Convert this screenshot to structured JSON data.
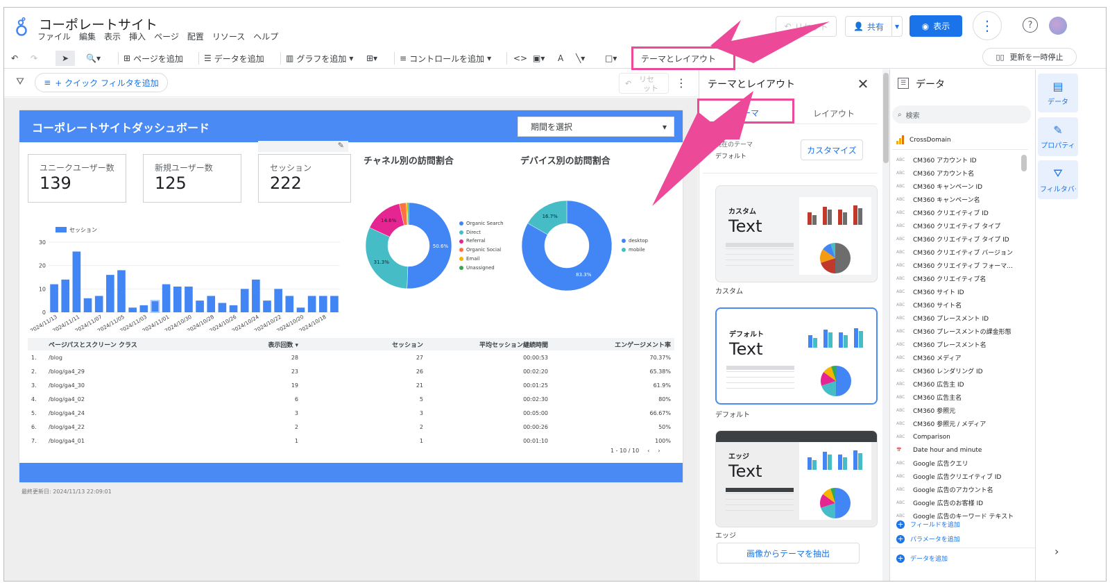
{
  "app": {
    "title": "コーポレートサイト",
    "menu": [
      "ファイル",
      "編集",
      "表示",
      "挿入",
      "ページ",
      "配置",
      "リソース",
      "ヘルプ"
    ],
    "reset_label": "リセット",
    "share_label": "共有",
    "view_label": "表示"
  },
  "toolbar": {
    "add_page": "ページを追加",
    "add_data": "データを追加",
    "add_chart": "グラフを追加",
    "add_control": "コントロールを追加",
    "theme_layout": "テーマとレイアウト",
    "pause_update": "更新を一時停止"
  },
  "filter_bar": {
    "quick_filter": "+ クイック フィルタを追加",
    "reset_top": "リセ",
    "reset_bottom": "ット"
  },
  "report": {
    "title": "コーポレートサイトダッシュボード",
    "date_selector": "期間を選択",
    "scorecards": [
      {
        "label": "ユニークユーザー数",
        "value": "139"
      },
      {
        "label": "新規ユーザー数",
        "value": "125"
      },
      {
        "label": "セッション",
        "value": "222"
      }
    ],
    "channel_title": "チャネル別の訪問割合",
    "device_title": "デバイス別の訪問割合",
    "last_updated": "最終更新日: 2024/11/13 22:09:01",
    "table": {
      "headers": [
        "ページパスとスクリーン クラス",
        "表示回数 ▾",
        "セッション",
        "平均セッション継続時間",
        "エンゲージメント率"
      ],
      "rows": [
        {
          "n": "1.",
          "path": "/blog",
          "views": "28",
          "sessions": "27",
          "dur": "00:00:53",
          "eng": "70.37%"
        },
        {
          "n": "2.",
          "path": "/blog/ga4_29",
          "views": "23",
          "sessions": "26",
          "dur": "00:02:20",
          "eng": "65.38%"
        },
        {
          "n": "3.",
          "path": "/blog/ga4_30",
          "views": "19",
          "sessions": "21",
          "dur": "00:01:25",
          "eng": "61.9%"
        },
        {
          "n": "4.",
          "path": "/blog/ga4_02",
          "views": "6",
          "sessions": "5",
          "dur": "00:02:30",
          "eng": "80%"
        },
        {
          "n": "5.",
          "path": "/blog/ga4_24",
          "views": "3",
          "sessions": "3",
          "dur": "00:05:00",
          "eng": "66.67%"
        },
        {
          "n": "6.",
          "path": "/blog/ga4_22",
          "views": "2",
          "sessions": "2",
          "dur": "00:00:26",
          "eng": "50%"
        },
        {
          "n": "7.",
          "path": "/blog/ga4_01",
          "views": "1",
          "sessions": "1",
          "dur": "00:01:10",
          "eng": "100%"
        }
      ],
      "pager": "1 - 10 / 10"
    }
  },
  "chart_data": [
    {
      "type": "bar",
      "series": [
        {
          "name": "セッション",
          "values": [
            12,
            14,
            26,
            6,
            7,
            16,
            18,
            2,
            3,
            5,
            12,
            11,
            11,
            5,
            7,
            4,
            3,
            10,
            14,
            5,
            10,
            7,
            2,
            7,
            7,
            7
          ]
        }
      ],
      "x_labels": [
        "2024/11/13",
        "2024/11/11",
        "2024/11/07",
        "2024/11/05",
        "2024/11/03",
        "2024/11/01",
        "2024/10/30",
        "2024/10/28",
        "2024/10/26",
        "2024/10/24",
        "2024/10/22",
        "2024/10/20",
        "2024/10/18"
      ],
      "yticks": [
        0,
        10,
        20,
        30
      ],
      "ylim": [
        0,
        30
      ]
    },
    {
      "type": "pie",
      "labels": [
        "Organic Search",
        "Direct",
        "Referral",
        "Organic Social",
        "Email",
        "Unassigned"
      ],
      "values": [
        50.6,
        31.3,
        14.6,
        2.5,
        0.5,
        0.5
      ],
      "colors": [
        "#4285f4",
        "#46bdc6",
        "#e52592",
        "#ff7043",
        "#f5b400",
        "#34a853"
      ],
      "data_labels": [
        "50.6%",
        "31.3%",
        "14.6%"
      ]
    },
    {
      "type": "pie",
      "labels": [
        "desktop",
        "mobile"
      ],
      "values": [
        83.3,
        16.7
      ],
      "colors": [
        "#4285f4",
        "#46bdc6"
      ],
      "data_labels": [
        "83.3%",
        "16.7%"
      ]
    }
  ],
  "theme_panel": {
    "title": "テーマとレイアウト",
    "tab_theme": "テーマ",
    "tab_layout": "レイアウト",
    "current_label": "現在のテーマ",
    "current_value": "デフォルト",
    "customize": "カスタマイズ",
    "cards": [
      {
        "tag": "カスタム",
        "text": "Text",
        "caption": "カスタム"
      },
      {
        "tag": "デフォルト",
        "text": "Text",
        "caption": "デフォルト"
      },
      {
        "tag": "エッジ",
        "text": "Text",
        "caption": "エッジ"
      }
    ],
    "extract": "画像からテーマを抽出"
  },
  "data_panel": {
    "title": "データ",
    "search_placeholder": "検索",
    "source": "CrossDomain",
    "fields": [
      "CM360 アカウント ID",
      "CM360 アカウント名",
      "CM360 キャンペーン ID",
      "CM360 キャンペーン名",
      "CM360 クリエイティブ ID",
      "CM360 クリエイティブ タイプ",
      "CM360 クリエイティブ タイプ ID",
      "CM360 クリエイティブ バージョン",
      "CM360 クリエイティブ フォーマ...",
      "CM360 クリエイティブ名",
      "CM360 サイト ID",
      "CM360 サイト名",
      "CM360 プレースメント ID",
      "CM360 プレースメントの課金形態",
      "CM360 プレースメント名",
      "CM360 メディア",
      "CM360 レンダリング ID",
      "CM360 広告主 ID",
      "CM360 広告主名",
      "CM360 参照元",
      "CM360 参照元 / メディア",
      "Comparison",
      "Date hour and minute",
      "Google 広告クエリ",
      "Google 広告クリエイティブ ID",
      "Google 広告のアカウント名",
      "Google 広告のお客様 ID",
      "Google 広告のキーワード テキスト"
    ],
    "add_field": "フィールドを追加",
    "add_param": "パラメータを追加",
    "add_data": "データを追加"
  },
  "rail": {
    "data": "データ",
    "properties": "プロパティ",
    "filter": "フィルタバー"
  },
  "colors": {
    "accent": "#1a73e8",
    "report_header": "#4a8af4",
    "highlight": "#ec4a99"
  }
}
